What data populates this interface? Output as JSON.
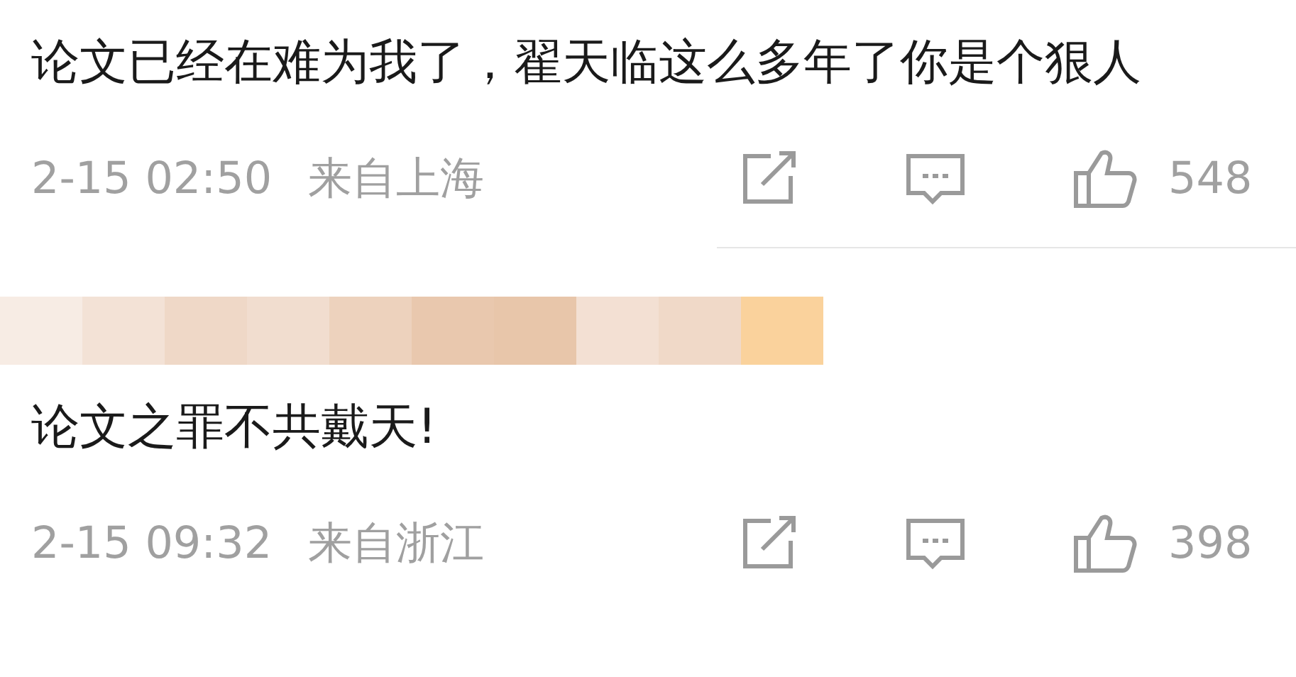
{
  "comments": [
    {
      "text": "论文已经在难为我了，翟天临这么多年了你是个狠人",
      "time": "2-15 02:50",
      "source": "来自上海",
      "likes": "548",
      "author": {
        "kind": "none"
      }
    },
    {
      "text": "论文之罪不共戴天!",
      "time": "2-15 09:32",
      "source": "来自浙江",
      "likes": "398"
    }
  ]
}
